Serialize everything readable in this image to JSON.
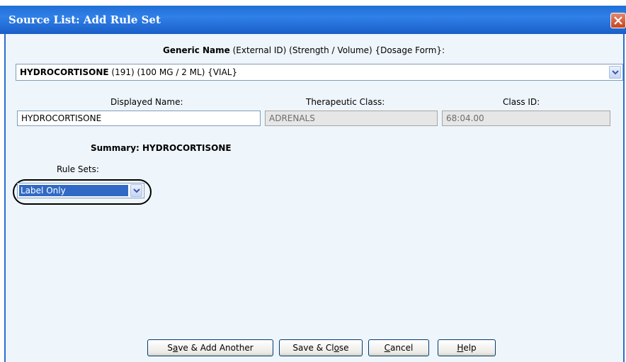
{
  "window": {
    "title": "Source List: Add Rule Set"
  },
  "generic_header": {
    "bold": "Generic Name",
    "rest": " (External ID) (Strength / Volume) {Dosage Form}:"
  },
  "generic_select": {
    "bold": "HYDROCORTISONE",
    "rest": " (191) (100 MG / 2 ML) {VIAL}"
  },
  "fields": {
    "displayed_name": {
      "label": "Displayed Name:",
      "value": "HYDROCORTISONE"
    },
    "therapeutic_class": {
      "label": "Therapeutic Class:",
      "value": "ADRENALS"
    },
    "class_id": {
      "label": "Class ID:",
      "value": "68:04.00"
    }
  },
  "summary": {
    "text": "Summary: HYDROCORTISONE"
  },
  "rule_sets": {
    "label": "Rule Sets:",
    "selected": "Label Only"
  },
  "buttons": {
    "save_add": {
      "pre": "S",
      "u": "a",
      "post": "ve & Add Another"
    },
    "save_close": {
      "pre": "Save & Cl",
      "u": "o",
      "post": "se"
    },
    "cancel": {
      "pre": "",
      "u": "C",
      "post": "ancel"
    },
    "help": {
      "pre": "",
      "u": "H",
      "post": "elp"
    }
  }
}
